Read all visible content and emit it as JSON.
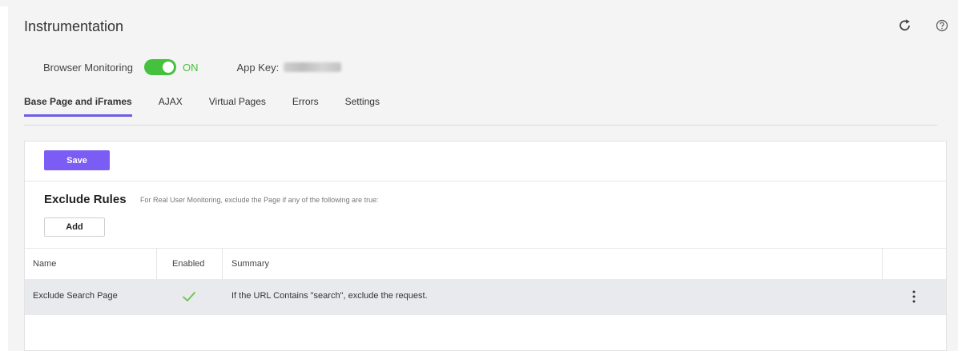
{
  "header": {
    "title": "Instrumentation",
    "refresh_icon": "refresh-icon",
    "help_icon": "help-icon"
  },
  "monitoring": {
    "label": "Browser Monitoring",
    "toggle_state": "ON",
    "app_key_label": "App Key:"
  },
  "tabs": [
    {
      "label": "Base Page and iFrames",
      "active": true
    },
    {
      "label": "AJAX",
      "active": false
    },
    {
      "label": "Virtual Pages",
      "active": false
    },
    {
      "label": "Errors",
      "active": false
    },
    {
      "label": "Settings",
      "active": false
    }
  ],
  "panel": {
    "save_label": "Save",
    "rules_title": "Exclude Rules",
    "rules_description": "For Real User Monitoring, exclude the Page if any of the following are true:",
    "add_label": "Add"
  },
  "table": {
    "columns": [
      "Name",
      "Enabled",
      "Summary"
    ],
    "rows": [
      {
        "name": "Exclude Search Page",
        "enabled": true,
        "summary": "If the URL Contains \"search\", exclude the request."
      }
    ]
  },
  "colors": {
    "accent": "#7b5cf5",
    "toggle_on": "#45c13d",
    "check": "#6cc24a"
  }
}
